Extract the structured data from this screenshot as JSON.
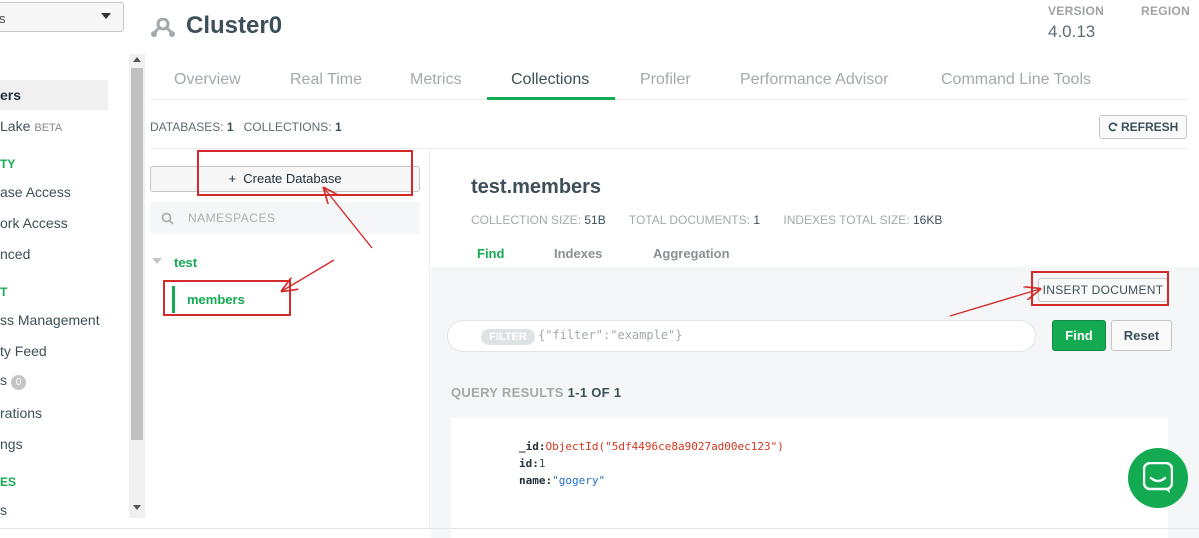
{
  "sidebar": {
    "project_select": "s",
    "items": [
      {
        "label": "ers",
        "active": true
      },
      {
        "label": "Lake",
        "badge": "BETA"
      },
      {
        "label": "ase Access"
      },
      {
        "label": "ork Access"
      },
      {
        "label": "nced"
      },
      {
        "label": "ss Management"
      },
      {
        "label": "ty Feed"
      },
      {
        "label": "s",
        "count": "0"
      },
      {
        "label": "rations"
      },
      {
        "label": "ngs"
      },
      {
        "label": "s"
      }
    ],
    "sections": [
      "TY",
      "T",
      "ES"
    ]
  },
  "header": {
    "cluster_name": "Cluster0",
    "version_label": "VERSION",
    "version_value": "4.0.13",
    "region_label": "REGION"
  },
  "tabs": [
    "Overview",
    "Real Time",
    "Metrics",
    "Collections",
    "Profiler",
    "Performance Advisor",
    "Command Line Tools"
  ],
  "active_tab": "Collections",
  "summary": {
    "databases_label": "DATABASES:",
    "databases_count": "1",
    "collections_label": "COLLECTIONS:",
    "collections_count": "1",
    "refresh_label": "REFRESH"
  },
  "db_panel": {
    "create_label": "Create Database",
    "create_icon": "+",
    "search_placeholder": "NAMESPACES",
    "database": "test",
    "collection": "members"
  },
  "collection": {
    "title": "test.members",
    "size_label": "COLLECTION SIZE:",
    "size_value": "51B",
    "docs_label": "TOTAL DOCUMENTS:",
    "docs_value": "1",
    "indexes_label": "INDEXES TOTAL SIZE:",
    "indexes_value": "16KB",
    "subtabs": [
      "Find",
      "Indexes",
      "Aggregation"
    ],
    "active_subtab": "Find"
  },
  "find": {
    "insert_label": "INSERT DOCUMENT",
    "filter_pill": "FILTER",
    "filter_placeholder": "{\"filter\":\"example\"}",
    "find_label": "Find",
    "reset_label": "Reset",
    "results_label": "QUERY RESULTS",
    "results_range": "1-1 OF 1"
  },
  "document": {
    "id_key": "_id:",
    "id_value": "ObjectId(\"5df4496ce8a9027ad00ec123\")",
    "num_key": "id:",
    "num_value": "1",
    "name_key": "name:",
    "name_value": "\"gogery\""
  },
  "colors": {
    "accent": "#13aa52",
    "annotation": "#d42a2a"
  }
}
